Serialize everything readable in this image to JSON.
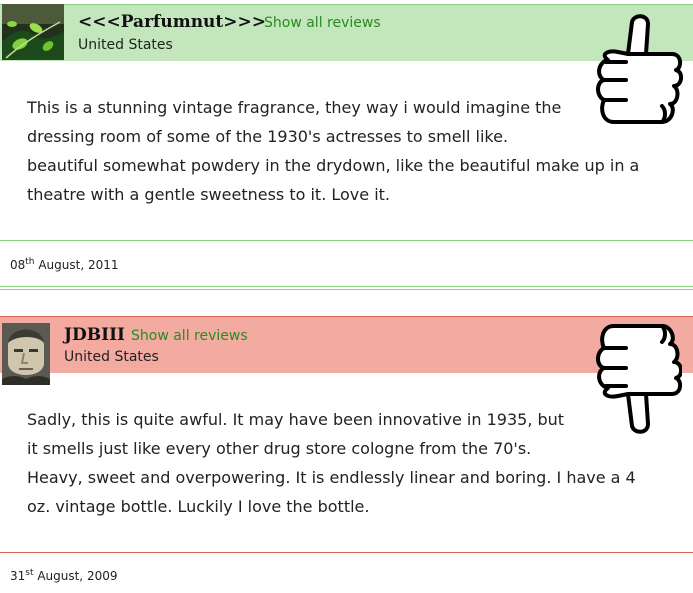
{
  "reviews": [
    {
      "username": "<<<Parfumnut>>>",
      "show_all_label": "Show all reviews",
      "country": "United States",
      "rating_icon": "thumbs-up-icon",
      "header_color": "#c3e6bc",
      "line_color": "#8ccf82",
      "lines": [
        "This is a stunning vintage fragrance, they way i would imagine the",
        "dressing room of some of the 1930's actresses to smell like.",
        "beautiful somewhat powdery in the drydown, like the beautiful make up in a",
        "theatre with a gentle sweetness to it. Love it."
      ],
      "date_day": "08",
      "date_suffix": "th",
      "date_rest": " August, 2011"
    },
    {
      "username": "JDBIII",
      "show_all_label": "Show all reviews",
      "country": "United States",
      "rating_icon": "thumbs-down-icon",
      "header_color": "#f2aaa1",
      "line_color": "#d9645a",
      "lines": [
        "Sadly, this is quite awful. It may have been innovative in 1935, but",
        "it smells just like every other drug store cologne from the 70's.",
        "Heavy, sweet and overpowering. It is endlessly linear and boring. I have a 4",
        "oz. vintage bottle. Luckily I love the bottle."
      ],
      "date_day": "31",
      "date_suffix": "st",
      "date_rest": " August, 2009"
    }
  ]
}
